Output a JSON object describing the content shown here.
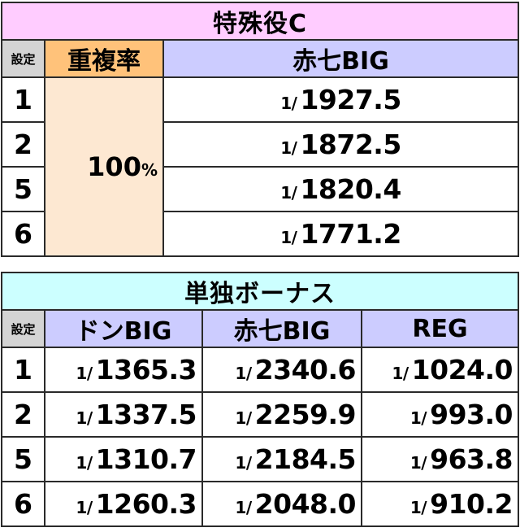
{
  "special_c": {
    "title": "特殊役C",
    "headers": {
      "setting": "設定",
      "overlap": "重複率",
      "col": "赤七BIG"
    },
    "overlap_value": "100",
    "overlap_unit": "%",
    "rows": [
      {
        "setting": "1",
        "prefix": "1/",
        "value": "1927.5"
      },
      {
        "setting": "2",
        "prefix": "1/",
        "value": "1872.5"
      },
      {
        "setting": "5",
        "prefix": "1/",
        "value": "1820.4"
      },
      {
        "setting": "6",
        "prefix": "1/",
        "value": "1771.2"
      }
    ]
  },
  "single_bonus": {
    "title": "単独ボーナス",
    "headers": {
      "setting": "設定",
      "don_big": "ドンBIG",
      "aka7_big": "赤七BIG",
      "reg": "REG"
    },
    "prefix": "1/",
    "rows": [
      {
        "setting": "1",
        "don_big": "1365.3",
        "aka7_big": "2340.6",
        "reg": "1024.0"
      },
      {
        "setting": "2",
        "don_big": "1337.5",
        "aka7_big": "2259.9",
        "reg": "993.0"
      },
      {
        "setting": "5",
        "don_big": "1310.7",
        "aka7_big": "2184.5",
        "reg": "963.8"
      },
      {
        "setting": "6",
        "don_big": "1260.3",
        "aka7_big": "2048.0",
        "reg": "910.2"
      }
    ]
  }
}
